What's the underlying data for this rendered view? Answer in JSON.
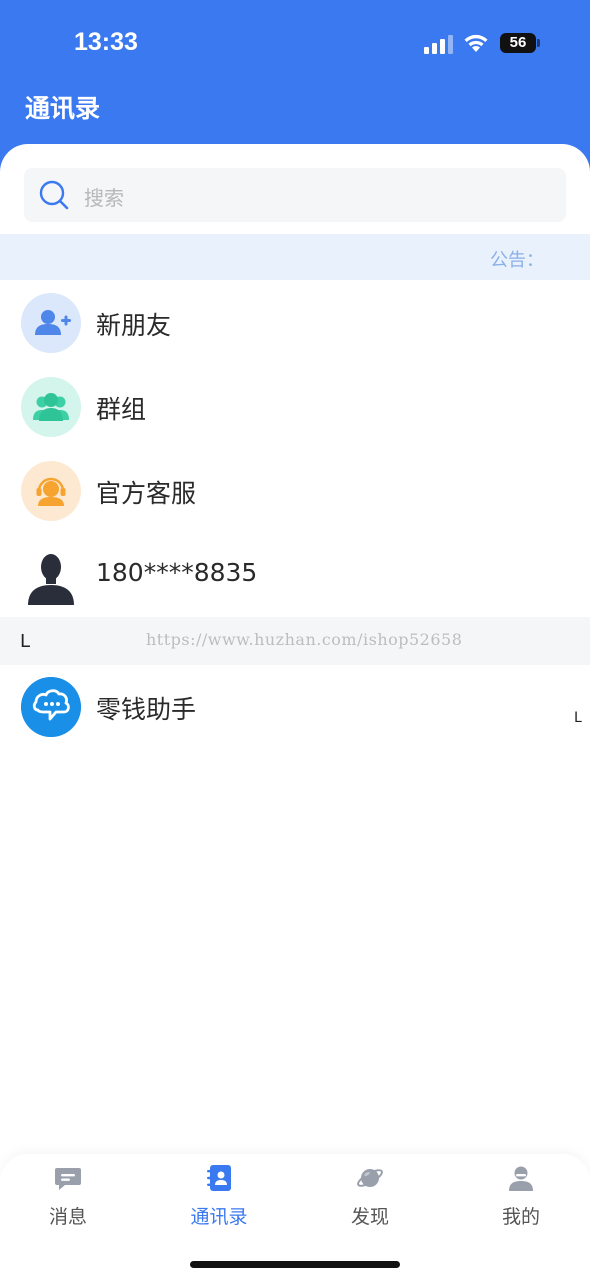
{
  "status_bar": {
    "time": "13:33",
    "battery": "56"
  },
  "header": {
    "title": "通讯录"
  },
  "search": {
    "placeholder": "搜索"
  },
  "notice": {
    "label": "公告："
  },
  "contacts": [
    {
      "label": "新朋友",
      "icon": "add-friend-icon"
    },
    {
      "label": "群组",
      "icon": "group-icon"
    },
    {
      "label": "官方客服",
      "icon": "customer-service-icon"
    },
    {
      "label": "180****8835",
      "icon": "user-silhouette-avatar"
    }
  ],
  "section": {
    "letter": "L",
    "watermark": "https://www.huzhan.com/ishop52658"
  },
  "section_contacts": [
    {
      "label": "零钱助手",
      "icon": "wallet-assistant-icon"
    }
  ],
  "index_bar": {
    "letter": "L"
  },
  "tabs": [
    {
      "label": "消息",
      "icon": "message-icon",
      "active": false
    },
    {
      "label": "通讯录",
      "icon": "contacts-icon",
      "active": true
    },
    {
      "label": "发现",
      "icon": "planet-icon",
      "active": false
    },
    {
      "label": "我的",
      "icon": "profile-icon",
      "active": false
    }
  ],
  "colors": {
    "brand": "#3b79f0",
    "notice_bg": "#e9f1fd",
    "section_bg": "#f5f6f8"
  }
}
